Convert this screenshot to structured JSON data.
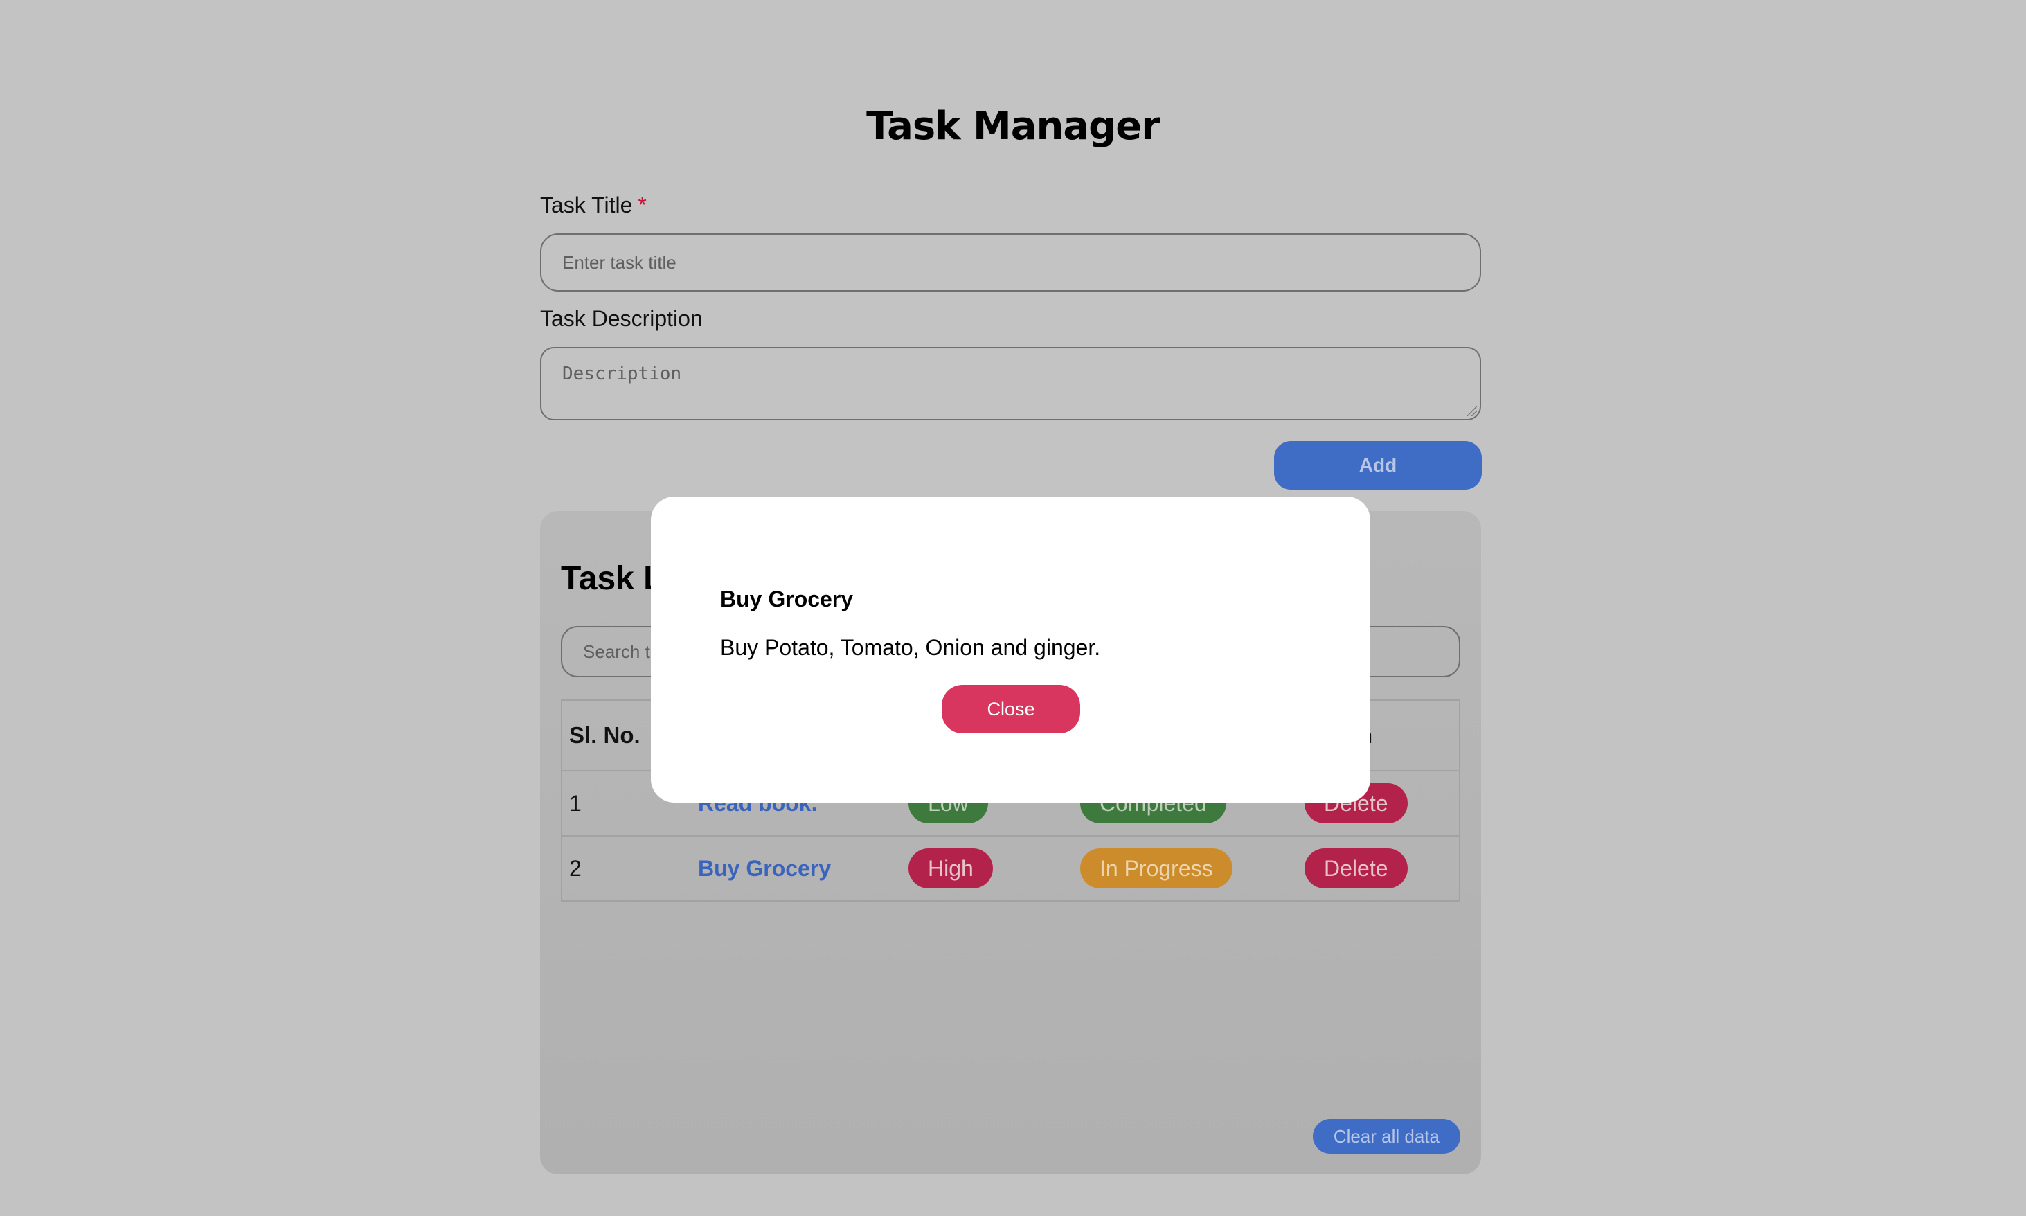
{
  "page": {
    "title": "Task Manager"
  },
  "form": {
    "title_label": "Task Title",
    "required_mark": "*",
    "title_placeholder": "Enter task title",
    "description_label": "Task Description",
    "description_placeholder": "Description",
    "add_label": "Add"
  },
  "task_list": {
    "title_visible": "Task L",
    "search_placeholder_visible": "Search t",
    "headers": {
      "sl_no": "Sl. No.",
      "action_visible": "n"
    },
    "rows": [
      {
        "sl_no": "1",
        "title": "Read book.",
        "priority": "Low",
        "status": "Completed",
        "action": "Delete"
      },
      {
        "sl_no": "2",
        "title": "Buy Grocery",
        "priority": "High",
        "status": "In Progress",
        "action": "Delete"
      }
    ],
    "clear_label": "Clear all data"
  },
  "modal": {
    "title": "Buy Grocery",
    "description": "Buy Potato, Tomato, Onion and ginger.",
    "close_label": "Close"
  },
  "colors": {
    "overlay_background": "#c3c3c3",
    "primary_blue": "#3f6cc4",
    "danger": "#d9365f",
    "success": "#3e7a3e",
    "warning": "#cc8c2c"
  }
}
